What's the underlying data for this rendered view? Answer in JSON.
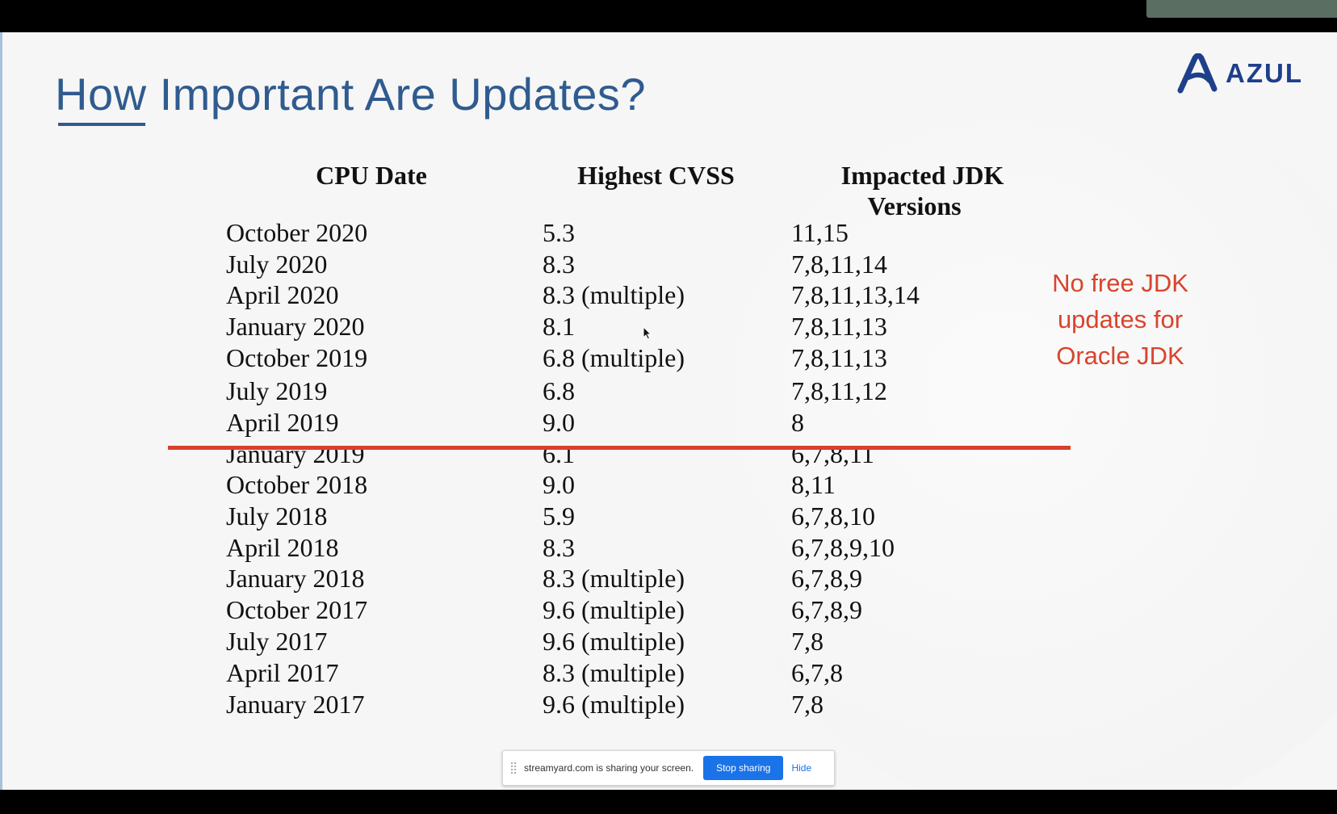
{
  "slide": {
    "title": "How Important Are Updates?",
    "logo_text": "AZUL",
    "columns": {
      "date": "CPU Date",
      "cvss": "Highest CVSS",
      "jdk_line1": "Impacted JDK",
      "jdk_line2": "Versions"
    },
    "rows": [
      {
        "date": "October 2020",
        "cvss": "5.3",
        "jdk": "11,15"
      },
      {
        "date": "July 2020",
        "cvss": "8.3",
        "jdk": "7,8,11,14"
      },
      {
        "date": "April 2020",
        "cvss": "8.3 (multiple)",
        "jdk": "7,8,11,13,14"
      },
      {
        "date": "January 2020",
        "cvss": "8.1",
        "jdk": "7,8,11,13"
      },
      {
        "date": "October 2019",
        "cvss": "6.8 (multiple)",
        "jdk": "7,8,11,13"
      },
      {
        "date": "July 2019",
        "cvss": "6.8",
        "jdk": "7,8,11,12"
      },
      {
        "date": "April 2019",
        "cvss": "9.0",
        "jdk": "8"
      },
      {
        "date": "January 2019",
        "cvss": "6.1",
        "jdk": "6,7,8,11"
      },
      {
        "date": "October 2018",
        "cvss": "9.0",
        "jdk": "8,11"
      },
      {
        "date": "July 2018",
        "cvss": "5.9",
        "jdk": "6,7,8,10"
      },
      {
        "date": "April 2018",
        "cvss": "8.3",
        "jdk": "6,7,8,9,10"
      },
      {
        "date": "January 2018",
        "cvss": "8.3 (multiple)",
        "jdk": "6,7,8,9"
      },
      {
        "date": "October 2017",
        "cvss": "9.6 (multiple)",
        "jdk": "6,7,8,9"
      },
      {
        "date": "July 2017",
        "cvss": "9.6 (multiple)",
        "jdk": "7,8"
      },
      {
        "date": "April 2017",
        "cvss": "8.3 (multiple)",
        "jdk": "6,7,8"
      },
      {
        "date": "January 2017",
        "cvss": "9.6 (multiple)",
        "jdk": "7,8"
      }
    ],
    "note_lines": [
      "No free JDK",
      "updates for",
      "Oracle JDK"
    ]
  },
  "share_bar": {
    "message": "streamyard.com is sharing your screen.",
    "stop_label": "Stop sharing",
    "hide_label": "Hide"
  },
  "colors": {
    "title": "#2f5b8f",
    "accent_red": "#d9402c",
    "logo": "#1e3f8a",
    "share_button": "#1a73e8"
  },
  "icons": {
    "logo_mark": "azul-logo-icon",
    "cursor": "mouse-cursor-icon",
    "drag": "drag-handle-icon"
  }
}
